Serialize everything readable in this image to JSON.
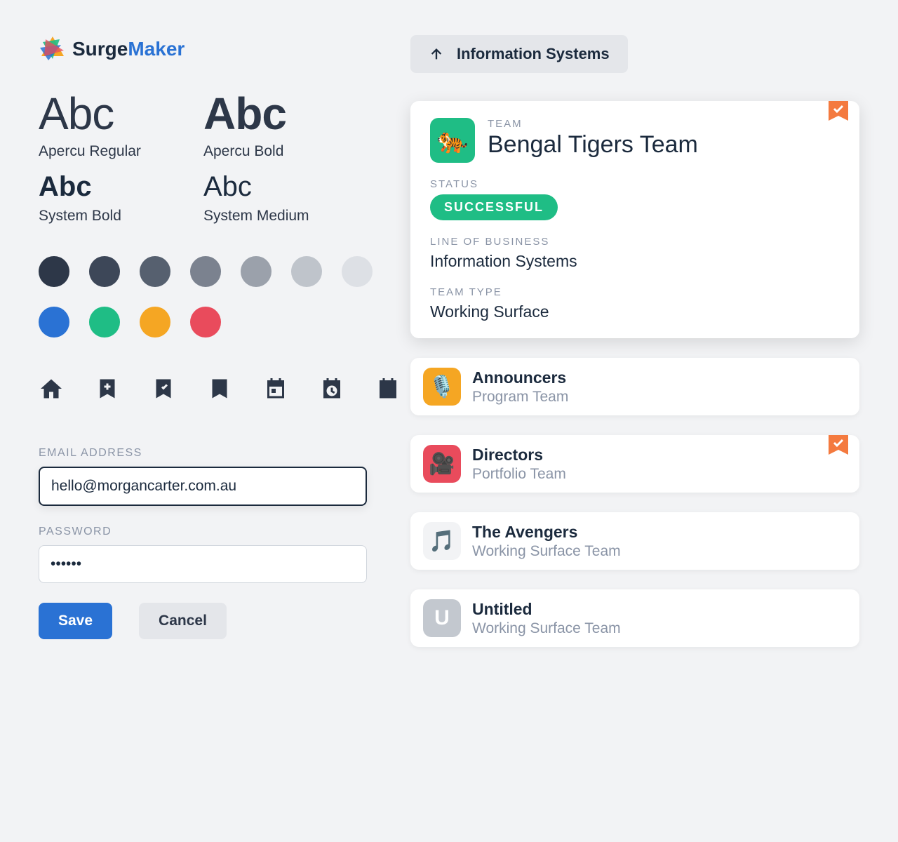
{
  "brand": {
    "name_a": "Surge",
    "name_b": "Maker"
  },
  "typography": [
    {
      "sample": "Abc",
      "label": "Apercu Regular",
      "size": "big",
      "weight": "regular"
    },
    {
      "sample": "Abc",
      "label": "Apercu Bold",
      "size": "big",
      "weight": "bold"
    },
    {
      "sample": "Abc",
      "label": "System Bold",
      "size": "med",
      "weight": "bold"
    },
    {
      "sample": "Abc",
      "label": "System Medium",
      "size": "med",
      "weight": "medium"
    }
  ],
  "palette_greys": [
    "#2d3748",
    "#3d4758",
    "#56606f",
    "#7b828f",
    "#9ba1ab",
    "#bfc4cb",
    "#dde0e5"
  ],
  "palette_accents": [
    "#2a72d4",
    "#1fbd85",
    "#f5a623",
    "#e94b5c"
  ],
  "icons": [
    "home",
    "bookmark-plus",
    "bookmark-check",
    "bookmark-x",
    "calendar-event",
    "calendar-clock",
    "calendar-check"
  ],
  "form": {
    "email_label": "EMAIL ADDRESS",
    "email_value": "hello@morgancarter.com.au",
    "password_label": "PASSWORD",
    "password_value": "••••••",
    "save_label": "Save",
    "cancel_label": "Cancel"
  },
  "breadcrumb": {
    "label": "Information Systems"
  },
  "featured_team": {
    "eyebrow": "TEAM",
    "name": "Bengal Tigers Team",
    "status_label": "STATUS",
    "status_value": "SUCCESSFUL",
    "lob_label": "LINE OF BUSINESS",
    "lob_value": "Information Systems",
    "type_label": "TEAM TYPE",
    "type_value": "Working Surface",
    "bookmarked": true,
    "avatar_emoji": "🐅"
  },
  "teams": [
    {
      "name": "Announcers",
      "subtitle": "Program Team",
      "avatar": "mic",
      "emoji": "🎙️",
      "bookmarked": false
    },
    {
      "name": "Directors",
      "subtitle": "Portfolio Team",
      "avatar": "camera",
      "emoji": "🎥",
      "bookmarked": true
    },
    {
      "name": "The Avengers",
      "subtitle": "Working Surface Team",
      "avatar": "music",
      "emoji": "🎵",
      "bookmarked": false
    },
    {
      "name": "Untitled",
      "subtitle": "Working Surface Team",
      "avatar": "letter",
      "letter": "U",
      "bookmarked": false
    }
  ]
}
